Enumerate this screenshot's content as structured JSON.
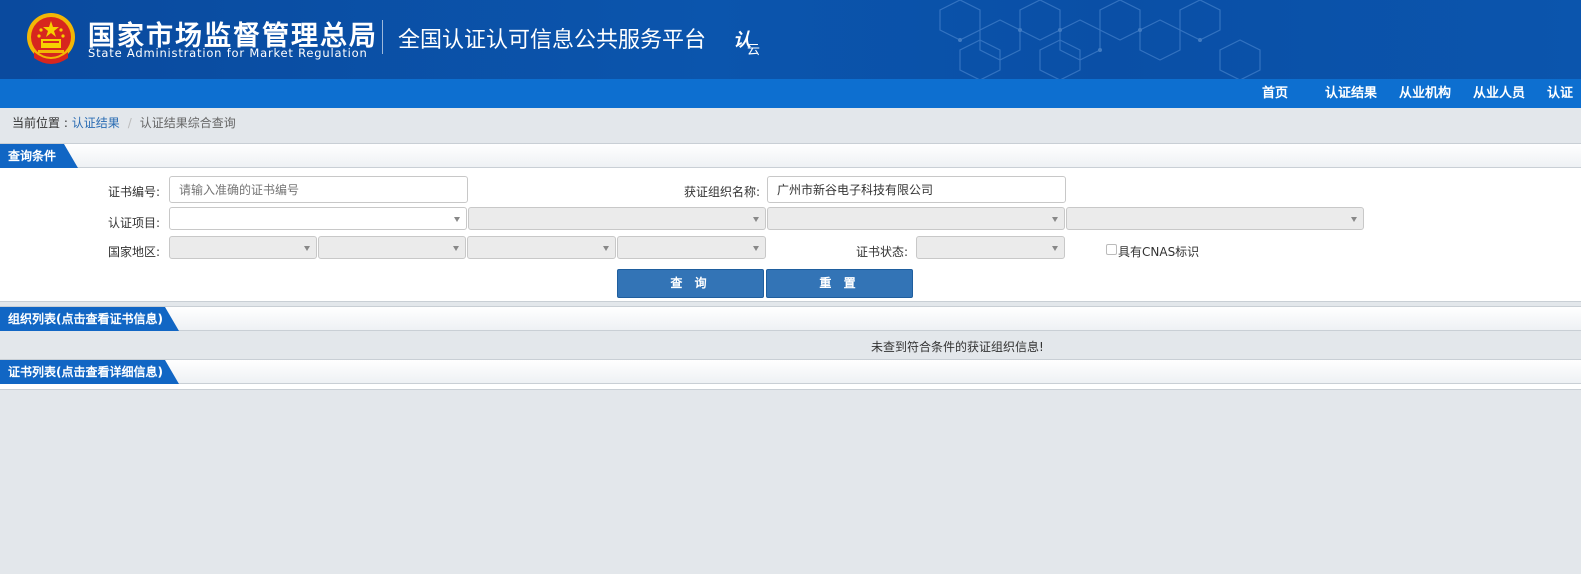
{
  "header": {
    "title_cn": "国家市场监督管理总局",
    "title_en": "State Administration  for  Market Regulation",
    "platform": "全国认证认可信息公共服务平台",
    "logo_text": "认",
    "logo_sub": "云"
  },
  "nav": {
    "items": [
      "首页",
      "认证结果",
      "从业机构",
      "从业人员",
      "认证"
    ]
  },
  "breadcrumb": {
    "label": "当前位置 : ",
    "link": "认证结果",
    "separator": "/",
    "current": "认证结果综合查询"
  },
  "query_panel": {
    "title": "查询条件",
    "cert_no_label": "证书编号:",
    "cert_no_placeholder": "请输入准确的证书编号",
    "org_name_label": "获证组织名称:",
    "org_name_value": "广州市新谷电子科技有限公司",
    "cert_project_label": "认证项目:",
    "region_label": "国家地区:",
    "cert_status_label": "证书状态:",
    "cnas_label": "具有CNAS标识",
    "search_button": "查 询",
    "reset_button": "重 置"
  },
  "org_panel": {
    "title": "组织列表(点击查看证书信息)",
    "empty_message": "未查到符合条件的获证组织信息!"
  },
  "cert_panel": {
    "title": "证书列表(点击查看详细信息)"
  },
  "colors": {
    "header_bg": "#0b55ad",
    "nav_bg": "#0d6fd0",
    "tab_bg": "#1166c4",
    "button_bg": "#3374b6",
    "link": "#2a6cb3"
  }
}
